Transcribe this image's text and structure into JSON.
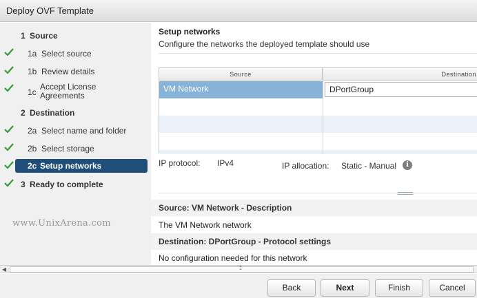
{
  "window": {
    "title": "Deploy OVF Template"
  },
  "wizard": {
    "steps": [
      {
        "num": "1",
        "label": "Source",
        "checked": false,
        "section": true
      },
      {
        "num": "1a",
        "label": "Select source",
        "checked": true
      },
      {
        "num": "1b",
        "label": "Review details",
        "checked": true
      },
      {
        "num": "1c",
        "label_line1": "Accept License",
        "label_line2": "Agreements",
        "checked": true
      },
      {
        "num": "2",
        "label": "Destination",
        "checked": false,
        "section": true
      },
      {
        "num": "2a",
        "label": "Select name and folder",
        "checked": true
      },
      {
        "num": "2b",
        "label": "Select storage",
        "checked": true
      },
      {
        "num": "2c",
        "label": "Setup networks",
        "checked": true,
        "active": true
      },
      {
        "num": "3",
        "label": "Ready to complete",
        "checked": true,
        "section": true
      }
    ]
  },
  "watermark": "www.UnixArena.com",
  "main": {
    "title": "Setup networks",
    "subtitle": "Configure the networks the deployed template should use",
    "grid": {
      "columns": [
        "Source",
        "Destination"
      ],
      "rows": [
        {
          "source": "VM Network",
          "destination": "DPortGroup"
        }
      ]
    },
    "ip_protocol_label": "IP protocol:",
    "ip_protocol_value": "IPv4",
    "ip_allocation_label": "IP allocation:",
    "ip_allocation_value": "Static - Manual",
    "source_desc_title": "Source: VM Network - Description",
    "source_desc_text": "The VM Network network",
    "dest_title": "Destination: DPortGroup - Protocol settings",
    "dest_text": "No configuration needed for this network"
  },
  "buttons": {
    "back": "Back",
    "next": "Next",
    "finish": "Finish",
    "cancel": "Cancel"
  },
  "colors": {
    "active_step": "#1f4e79",
    "selected_row": "#87b3d8",
    "check": "#2e9e3a"
  }
}
